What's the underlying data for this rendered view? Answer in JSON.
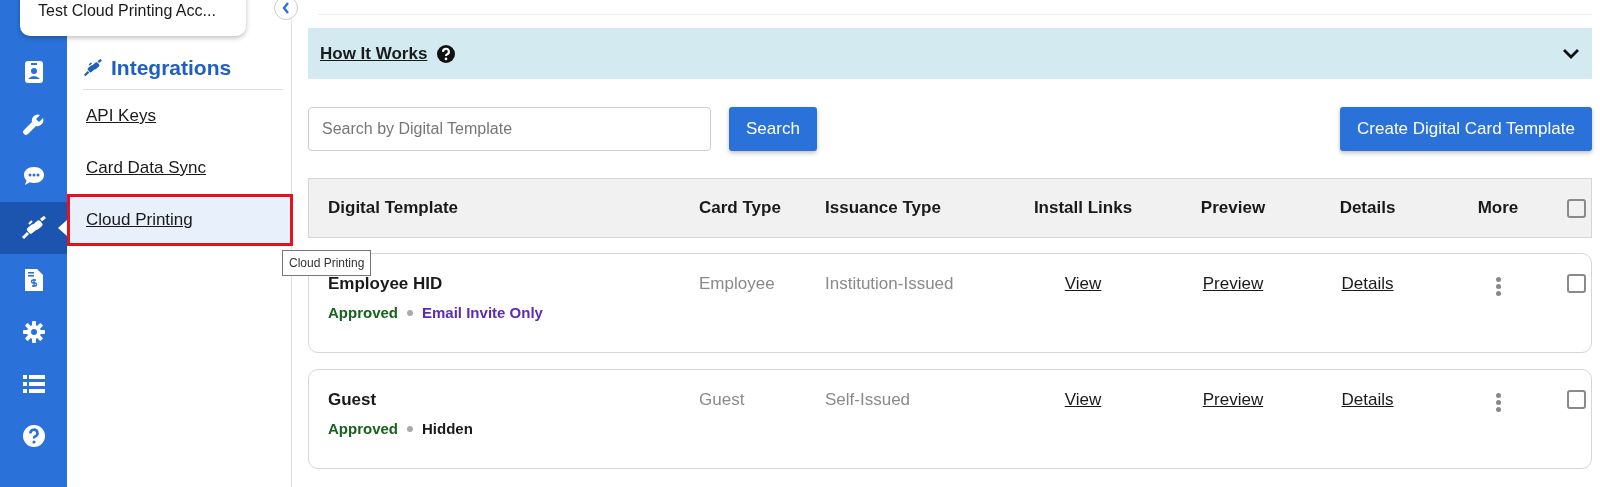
{
  "account": {
    "name": "Test Cloud Printing Acc..."
  },
  "rail": {
    "items": [
      {
        "kind": "badge",
        "selected": false
      },
      {
        "kind": "wrench",
        "selected": false
      },
      {
        "kind": "chat",
        "selected": false
      },
      {
        "kind": "plug",
        "selected": true
      },
      {
        "kind": "invoice",
        "selected": false
      },
      {
        "kind": "gear",
        "selected": false
      },
      {
        "kind": "list",
        "selected": false
      },
      {
        "kind": "help",
        "selected": false
      }
    ]
  },
  "subnav": {
    "title": "Integrations",
    "items": [
      {
        "label": "API Keys",
        "selected": false
      },
      {
        "label": "Card Data Sync",
        "selected": false
      },
      {
        "label": "Cloud Printing",
        "selected": true
      }
    ]
  },
  "tooltip": "Cloud Printing",
  "how_it_works": {
    "label": "How It Works",
    "expanded": false
  },
  "search": {
    "placeholder": "Search by Digital Template",
    "button": "Search"
  },
  "create_button": "Create Digital Card Template",
  "table": {
    "columns": [
      "Digital Template",
      "Card Type",
      "Issuance Type",
      "Install Links",
      "Preview",
      "Details",
      "More"
    ],
    "select_all_checked": false,
    "rows": [
      {
        "name": "Employee HID",
        "status": "Approved",
        "visibility": {
          "label": "Email Invite Only",
          "color": "#5b2bb5"
        },
        "card_type": "Employee",
        "issuance_type": "Institution-Issued",
        "install_link": "View",
        "preview": "Preview",
        "details": "Details",
        "checked": false
      },
      {
        "name": "Guest",
        "status": "Approved",
        "visibility": {
          "label": "Hidden",
          "color": "#1a1a1a"
        },
        "card_type": "Guest",
        "issuance_type": "Self-Issued",
        "install_link": "View",
        "preview": "Preview",
        "details": "Details",
        "checked": false
      }
    ]
  }
}
